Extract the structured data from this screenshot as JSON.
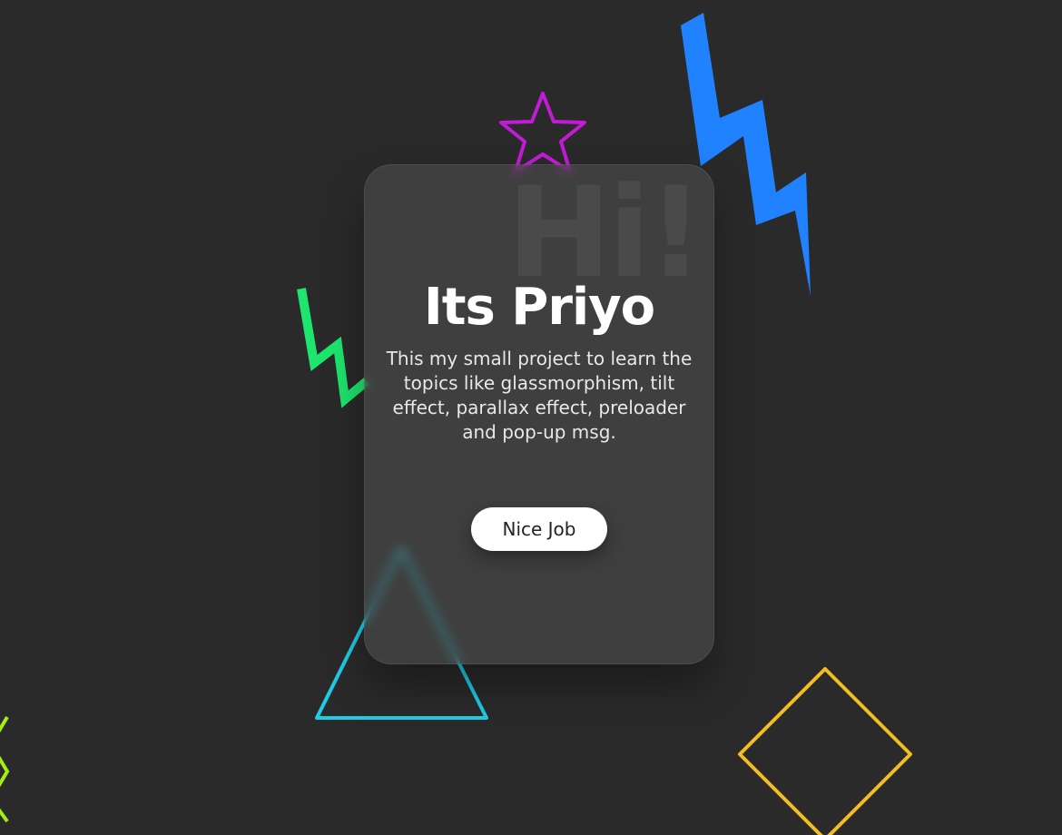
{
  "card": {
    "watermark": "Hi!",
    "title": "Its Priyo",
    "description": "This my small project to learn the topics like glassmorphism, tilt effect, parallax effect, preloader and pop-up msg.",
    "button_label": "Nice Job"
  },
  "decorations": [
    {
      "icon": "star-outline-icon",
      "color": "#c21bd6"
    },
    {
      "icon": "lightning-bolt-icon",
      "color": "#2182ff"
    },
    {
      "icon": "lightning-bolt-icon",
      "color": "#1ee56e"
    },
    {
      "icon": "triangle-outline-icon",
      "color": "#1fcbe6"
    },
    {
      "icon": "diamond-outline-icon",
      "color": "#f2bd22"
    },
    {
      "icon": "zigzag-icon",
      "color": "#a2ee15"
    }
  ],
  "colors": {
    "background": "#2a2a2a",
    "card": "#484848",
    "button": "#ffffff"
  }
}
